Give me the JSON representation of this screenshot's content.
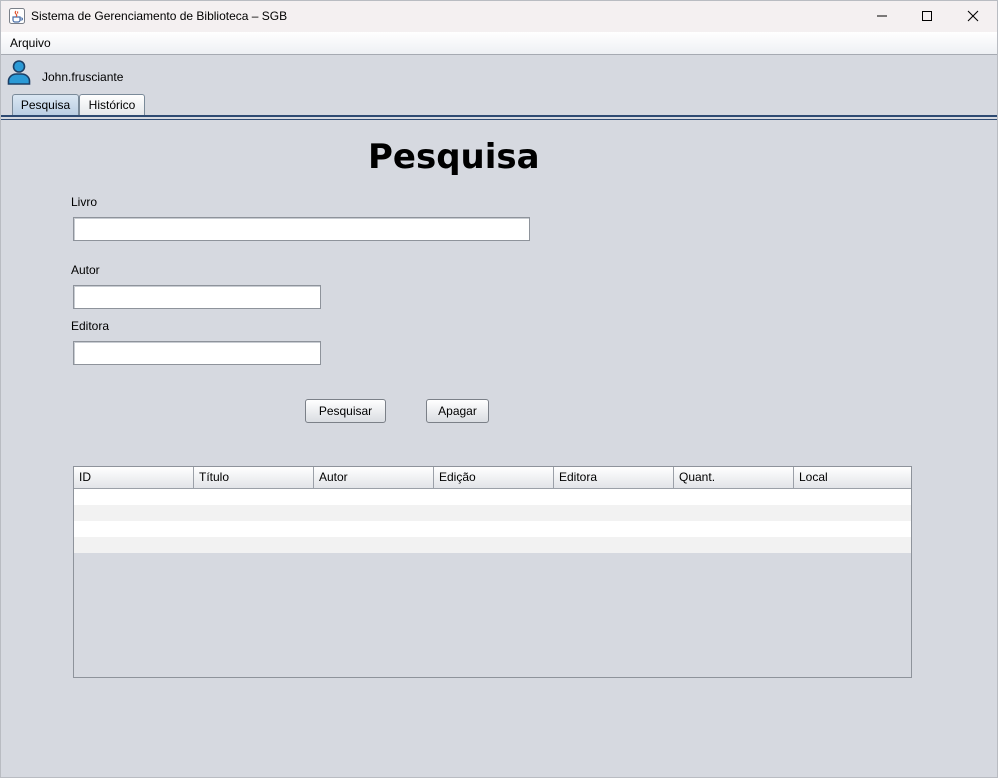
{
  "window": {
    "title": "Sistema de Gerenciamento de Biblioteca – SGB"
  },
  "menubar": {
    "items": [
      {
        "label": "Arquivo"
      }
    ]
  },
  "user": {
    "name": "John.frusciante"
  },
  "tabs": [
    {
      "label": "Pesquisa",
      "active": true
    },
    {
      "label": "Histórico",
      "active": false
    }
  ],
  "page": {
    "title": "Pesquisa"
  },
  "form": {
    "livro": {
      "label": "Livro",
      "value": ""
    },
    "autor": {
      "label": "Autor",
      "value": ""
    },
    "editora": {
      "label": "Editora",
      "value": ""
    }
  },
  "buttons": {
    "search": "Pesquisar",
    "clear": "Apagar"
  },
  "table": {
    "columns": [
      "ID",
      "Título",
      "Autor",
      "Edição",
      "Editora",
      "Quant.",
      "Local"
    ],
    "rows": [],
    "row_colors": [
      "#ffffff",
      "#f2f2f2"
    ]
  },
  "colors": {
    "background": "#d6d9e0",
    "title_bar": "#f4f0f1",
    "tab_active": "#b8cde2",
    "tab_border_line": "#2e4a72"
  },
  "icons": {
    "app": "java-cup-icon",
    "user": "user-icon",
    "minimize": "minimize-icon",
    "maximize": "maximize-icon",
    "close": "close-icon"
  }
}
